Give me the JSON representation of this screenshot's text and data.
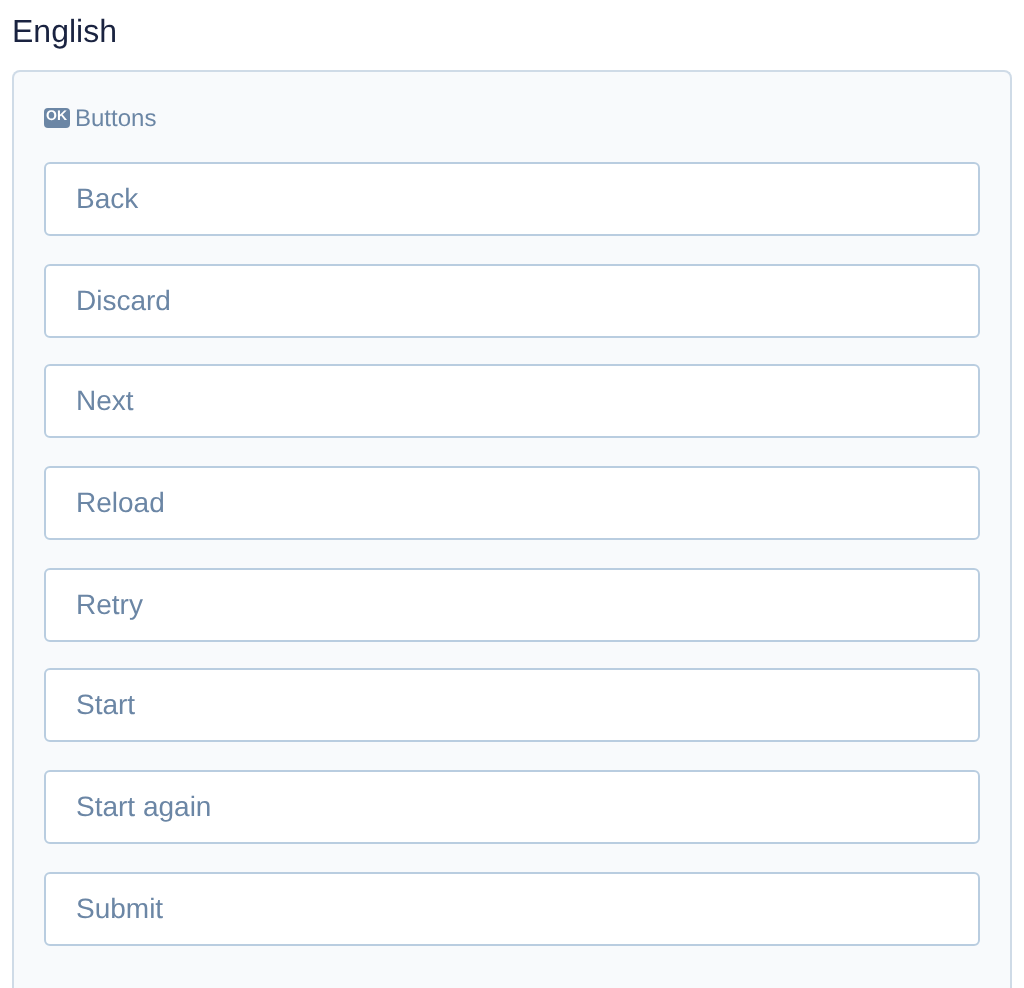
{
  "heading": "English",
  "panel": {
    "icon_text": "OK",
    "label": "Buttons",
    "buttons": [
      "Back",
      "Discard",
      "Next",
      "Reload",
      "Retry",
      "Start",
      "Start again",
      "Submit"
    ]
  }
}
